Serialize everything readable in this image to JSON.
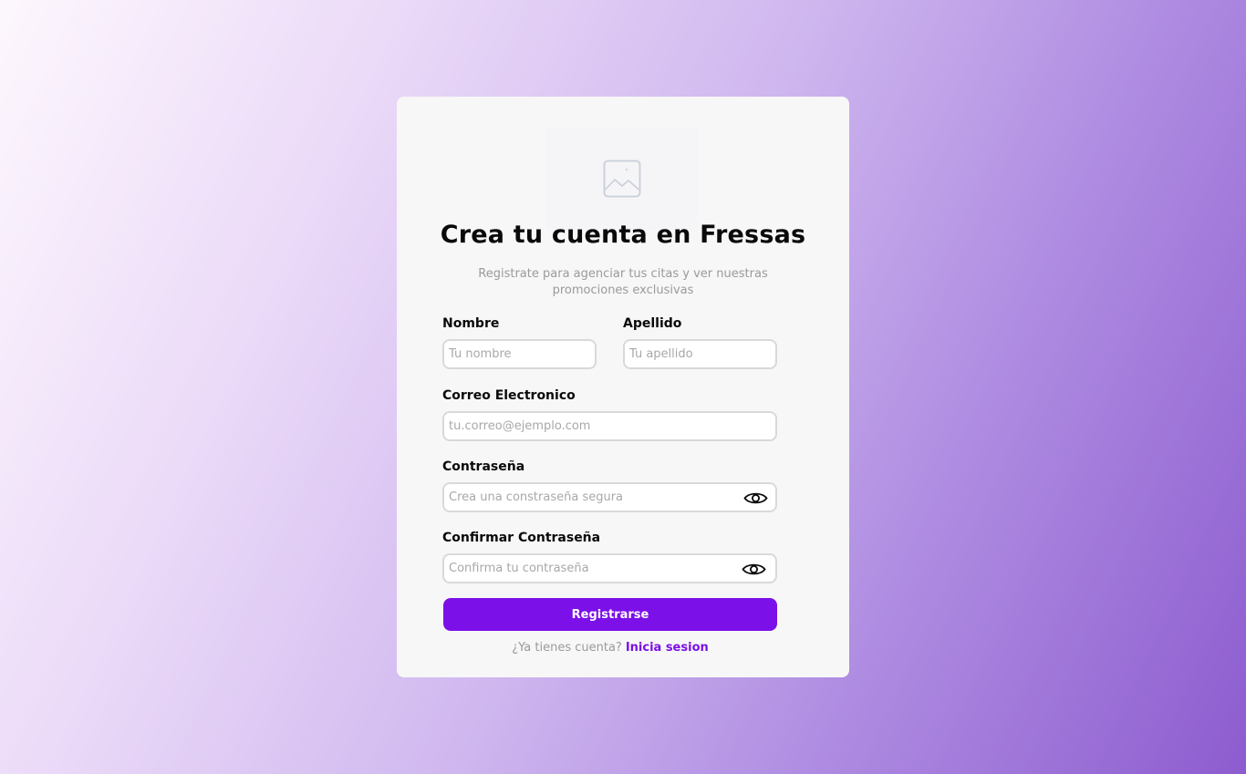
{
  "header": {
    "title": "Crea tu cuenta en Fressas",
    "subtitle": "Registrate para agenciar tus citas y ver nuestras promociones exclusivas",
    "logo_icon": "image-placeholder-icon"
  },
  "form": {
    "nombre": {
      "label": "Nombre",
      "placeholder": "Tu nombre",
      "value": ""
    },
    "apellido": {
      "label": "Apellido",
      "placeholder": "Tu apellido",
      "value": ""
    },
    "correo": {
      "label": "Correo Electronico",
      "placeholder": "tu.correo@ejemplo.com",
      "value": ""
    },
    "password": {
      "label": "Contraseña",
      "placeholder": "Crea una constraseña segura",
      "value": "",
      "toggle_icon": "eye-icon"
    },
    "confirm_password": {
      "label": "Confirmar Contraseña",
      "placeholder": "Confirma tu contraseña",
      "value": "",
      "toggle_icon": "eye-icon"
    },
    "submit_label": "Registrarse"
  },
  "footer": {
    "prompt": "¿Ya tienes cuenta?",
    "link_label": "Inicia sesion"
  },
  "colors": {
    "accent": "#7b10e8",
    "card_background": "#f7f7f7",
    "input_border": "#d9d9d9",
    "muted_text": "#9a9a9a"
  }
}
